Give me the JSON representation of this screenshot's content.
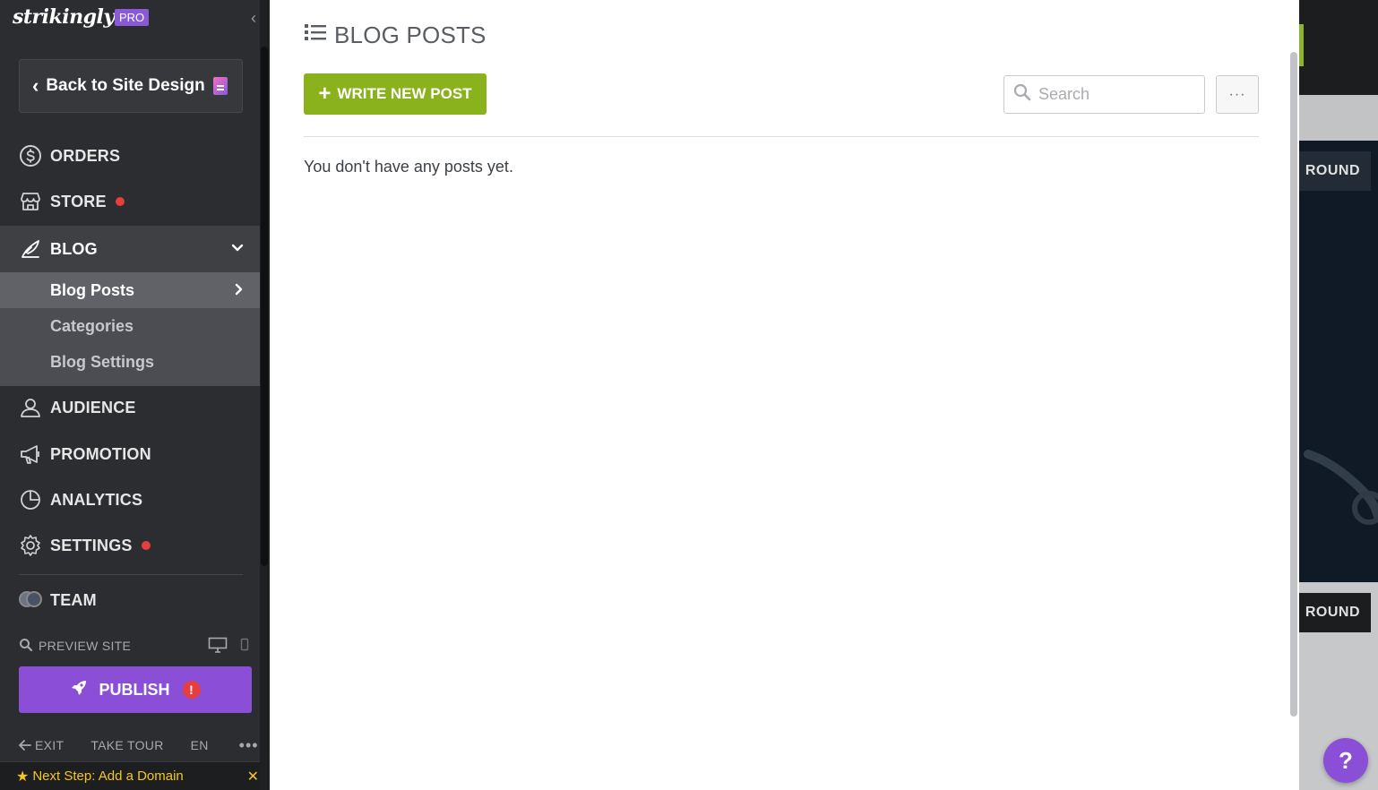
{
  "sidebar": {
    "logo": "strikingly",
    "plan_badge": "PRO",
    "back_button_label": "Back to Site Design",
    "nav": {
      "orders": "ORDERS",
      "store": "STORE",
      "blog": "BLOG",
      "audience": "AUDIENCE",
      "promotion": "PROMOTION",
      "analytics": "ANALYTICS",
      "settings": "SETTINGS",
      "team": "TEAM"
    },
    "blog_sub": {
      "posts": "Blog Posts",
      "categories": "Categories",
      "settings": "Blog Settings"
    },
    "preview_label": "PREVIEW SITE",
    "publish_label": "PUBLISH",
    "publish_alert": "!",
    "footer": {
      "exit": "EXIT",
      "tour": "TAKE TOUR",
      "lang": "EN",
      "more": "•••"
    },
    "next_step": "Next Step: Add a Domain"
  },
  "main": {
    "title": "BLOG POSTS",
    "write_button": "WRITE NEW POST",
    "search_placeholder": "Search",
    "more_button": "···",
    "empty_message": "You don't have any posts yet."
  },
  "backdrop": {
    "button_text_1": "ROUND",
    "button_text_2": "ROUND",
    "help_label": "?"
  },
  "colors": {
    "sidebar_bg": "#2c2d30",
    "accent_purple": "#8a4fd6",
    "accent_green": "#89b21c",
    "status_red": "#e53e3e",
    "next_step_yellow": "#f3c627"
  },
  "icons": {
    "orders": "dollar-circle-icon",
    "store": "storefront-icon",
    "blog": "quill-icon",
    "audience": "user-icon",
    "promotion": "megaphone-icon",
    "analytics": "pie-chart-icon",
    "settings": "gear-icon",
    "team": "team-avatars-icon"
  }
}
